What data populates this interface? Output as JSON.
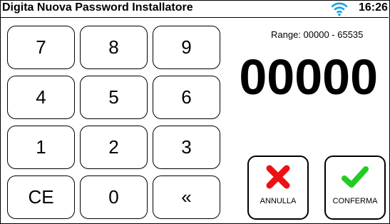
{
  "header": {
    "title": "Digita Nuova Password Installatore",
    "time": "16:26",
    "wifi_icon": "wifi-icon",
    "wifi_color": "#1aa0e8"
  },
  "keypad": {
    "keys": [
      "7",
      "8",
      "9",
      "4",
      "5",
      "6",
      "1",
      "2",
      "3",
      "CE",
      "0",
      "«"
    ]
  },
  "range_label": "Range: 00000 - 65535",
  "display_value": "00000",
  "actions": {
    "cancel_label": "ANNULLA",
    "cancel_icon": "x-icon",
    "cancel_color": "#ee1111",
    "confirm_label": "CONFERMA",
    "confirm_icon": "check-icon",
    "confirm_color": "#22cc22"
  }
}
